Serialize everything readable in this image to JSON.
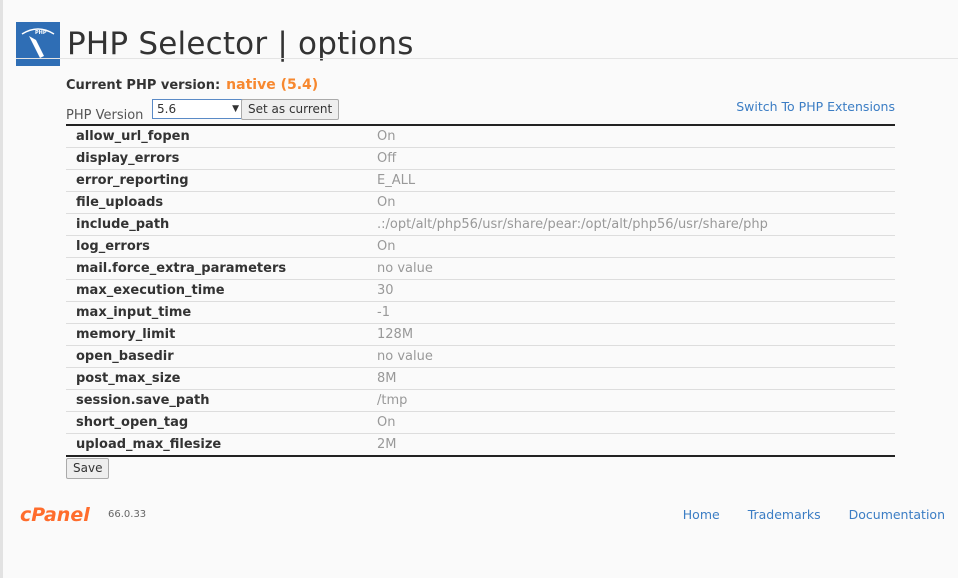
{
  "header": {
    "title": "PHP Selector | options",
    "icon": "php-gauge-icon"
  },
  "current": {
    "label": "Current PHP version:",
    "value": "native (5.4)"
  },
  "version": {
    "label": "PHP Version",
    "selected": "5.6",
    "set_label": "Set as current",
    "extensions_link": "Switch To PHP Extensions"
  },
  "options": [
    {
      "name": "allow_url_fopen",
      "value": "On"
    },
    {
      "name": "display_errors",
      "value": "Off"
    },
    {
      "name": "error_reporting",
      "value": "E_ALL"
    },
    {
      "name": "file_uploads",
      "value": "On"
    },
    {
      "name": "include_path",
      "value": ".:/opt/alt/php56/usr/share/pear:/opt/alt/php56/usr/share/php"
    },
    {
      "name": "log_errors",
      "value": "On"
    },
    {
      "name": "mail.force_extra_parameters",
      "value": "no value"
    },
    {
      "name": "max_execution_time",
      "value": "30"
    },
    {
      "name": "max_input_time",
      "value": "-1"
    },
    {
      "name": "memory_limit",
      "value": "128M"
    },
    {
      "name": "open_basedir",
      "value": "no value"
    },
    {
      "name": "post_max_size",
      "value": "8M"
    },
    {
      "name": "session.save_path",
      "value": "/tmp"
    },
    {
      "name": "short_open_tag",
      "value": "On"
    },
    {
      "name": "upload_max_filesize",
      "value": "2M"
    }
  ],
  "save_label": "Save",
  "footer": {
    "logo": "cPanel",
    "version": "66.0.33",
    "links": [
      "Home",
      "Trademarks",
      "Documentation"
    ]
  },
  "colors": {
    "accent": "#f7882f",
    "link": "#3b7dc4"
  }
}
